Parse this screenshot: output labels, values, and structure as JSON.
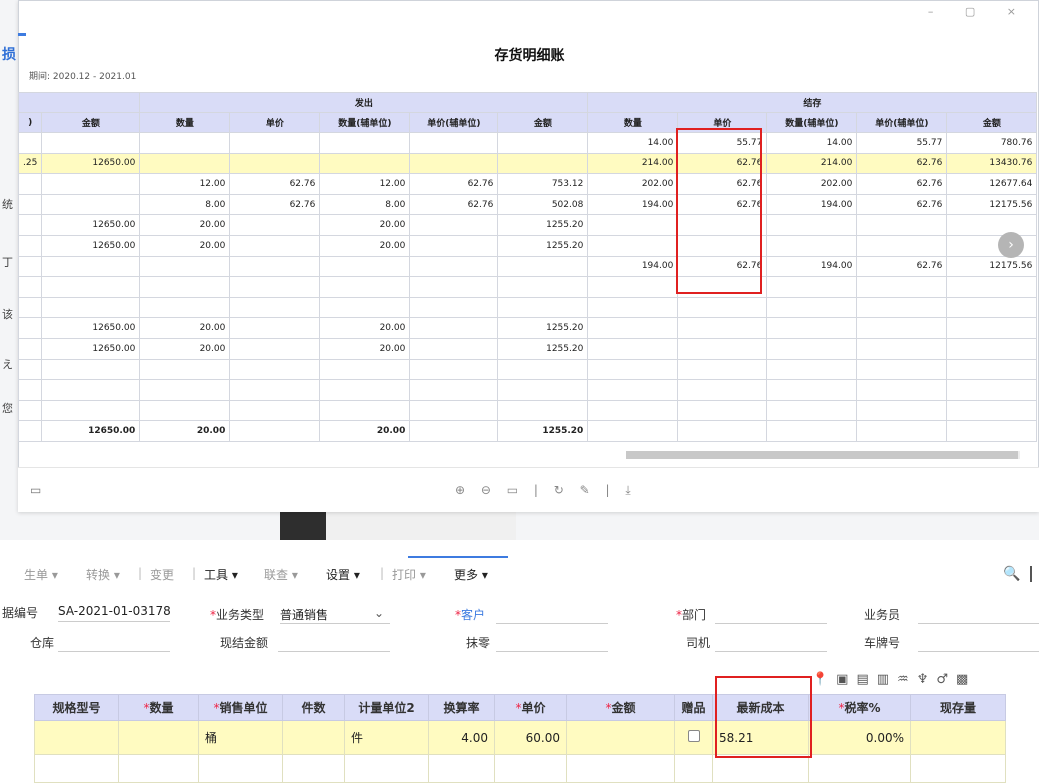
{
  "viewer": {
    "title": "存货明细账",
    "period_label": "期间:",
    "period_value": "2020.12 - 2021.01",
    "window_controls": "–  ▢  ×",
    "group_out": "发出",
    "group_balance": "结存",
    "headers": [
      "",
      "金额",
      "数量",
      "单价",
      "数量(辅单位)",
      "单价(辅单位)",
      "金额",
      "数量",
      "单价",
      "数量(辅单位)",
      "单价(辅单位)",
      "金额"
    ],
    "first_col_header": ")",
    "rows": [
      {
        "hl": false,
        "cells": [
          "",
          "",
          "",
          "",
          "",
          "",
          "",
          "14.00",
          "55.77",
          "14.00",
          "55.77",
          "780.76"
        ]
      },
      {
        "hl": true,
        "cells": ".25|12650.00||||||214.00|62.76|214.00|62.76|13430.76"
      },
      {
        "hl": false,
        "cells": "||12.00|62.76|12.00|62.76|753.12|202.00|62.76|202.00|62.76|12677.64"
      },
      {
        "hl": false,
        "cells": "||8.00|62.76|8.00|62.76|502.08|194.00|62.76|194.00|62.76|12175.56"
      },
      {
        "hl": false,
        "cells": "|12650.00|20.00||20.00||1255.20|||||"
      },
      {
        "hl": false,
        "cells": "|12650.00|20.00||20.00||1255.20|||||"
      },
      {
        "hl": false,
        "cells": "|||||||194.00|62.76|194.00|62.76|12175.56"
      },
      {
        "hl": false,
        "cells": "|||||||||||"
      },
      {
        "hl": false,
        "cells": "|||||||||||"
      },
      {
        "hl": false,
        "cells": "|12650.00|20.00||20.00||1255.20|||||"
      },
      {
        "hl": false,
        "cells": "|12650.00|20.00||20.00||1255.20|||||"
      },
      {
        "hl": false,
        "cells": "|||||||||||"
      },
      {
        "hl": false,
        "cells": "|||||||||||"
      },
      {
        "hl": false,
        "cells": "|||||||||||"
      }
    ],
    "total_row": [
      "",
      "12650.00",
      "20.00",
      "",
      "20.00",
      "",
      "1255.20",
      "",
      "",
      "",
      "",
      ""
    ],
    "toolbar_icons": "⊕ ⊖ ▭ | ↻ ✎ | ⤓",
    "save_icon": "▭",
    "next_arrow": "›"
  },
  "left_glyphs": [
    "损",
    "统",
    "丁",
    "该",
    "え",
    "您"
  ],
  "menu": {
    "items": [
      {
        "label": "生单 ▾",
        "style": "muted"
      },
      {
        "label": "转换 ▾",
        "style": "muted"
      },
      {
        "label": "变更",
        "style": "muted"
      },
      {
        "label": "工具 ▾",
        "style": "dark"
      },
      {
        "label": "联查 ▾",
        "style": "muted"
      },
      {
        "label": "设置 ▾",
        "style": "dark"
      },
      {
        "label": "打印 ▾",
        "style": "muted"
      },
      {
        "label": "更多 ▾",
        "style": "dark"
      }
    ],
    "search_icon": "🔍"
  },
  "form": {
    "doc_no_label": "据编号",
    "doc_no_value": "SA-2021-01-03178",
    "biz_type_label": "业务类型",
    "biz_type_value": "普通销售",
    "customer_label": "客户",
    "dept_label": "部门",
    "salesman_label": "业务员",
    "warehouse_label": "仓库",
    "cash_label": "现结金额",
    "writeoff_label": "抹零",
    "driver_label": "司机",
    "plate_label": "车牌号"
  },
  "grid": {
    "headers": [
      {
        "label": "规格型号",
        "req": false
      },
      {
        "label": "数量",
        "req": true
      },
      {
        "label": "销售单位",
        "req": true
      },
      {
        "label": "件数",
        "req": false
      },
      {
        "label": "计量单位2",
        "req": false
      },
      {
        "label": "换算率",
        "req": false
      },
      {
        "label": "单价",
        "req": true
      },
      {
        "label": "金额",
        "req": true
      },
      {
        "label": "赠品",
        "req": false
      },
      {
        "label": "最新成本",
        "req": false
      },
      {
        "label": "税率%",
        "req": true
      },
      {
        "label": "现存量",
        "req": false
      }
    ],
    "row": {
      "spec": "",
      "qty": "",
      "unit": "桶",
      "pieces": "",
      "unit2": "件",
      "rate": "4.00",
      "price": "60.00",
      "amount": "",
      "latest_cost": "58.21",
      "tax": "0.00%",
      "stock": ""
    }
  }
}
